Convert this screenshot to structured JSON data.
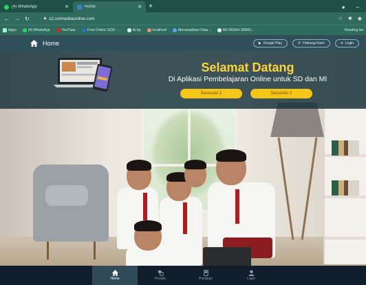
{
  "browser": {
    "tabs": [
      {
        "label": "(4) WhatsApp",
        "active": false
      },
      {
        "label": "Home",
        "active": true
      }
    ],
    "new_tab": "+",
    "url": "s2.unimediaonline.com",
    "bookmarks": [
      "Apps",
      "(4) WhatsApp",
      "YouTube",
      "Free Online OCR - ...",
      "tb.hp",
      "localhost",
      "Menampilkan Data...",
      "AN INDAH SMKN..."
    ],
    "bookmark_right": "Reading list"
  },
  "navbar": {
    "brand": "Home",
    "links": [
      {
        "label": "Google Play",
        "icon": "play-icon"
      },
      {
        "label": "Hubungi Kami",
        "icon": "phone-icon"
      },
      {
        "label": "Login",
        "icon": "login-icon"
      }
    ]
  },
  "hero": {
    "title": "Selamat Datang",
    "subtitle": "Di Aplikasi Pembelajaran Online untuk SD dan MI",
    "buttons": [
      "Semester 1",
      "Semester 2"
    ]
  },
  "bottom_nav": [
    {
      "label": "Home",
      "icon": "home-icon",
      "active": true
    },
    {
      "label": "Produk",
      "icon": "product-icon",
      "active": false
    },
    {
      "label": "Panduan",
      "icon": "guide-icon",
      "active": false
    },
    {
      "label": "Login",
      "icon": "user-icon",
      "active": false
    }
  ],
  "colors": {
    "navbar": "#2f4f5a",
    "accent_title": "#ffd43a",
    "button": "#f5c518",
    "bottom_nav": "#0f1e2a"
  }
}
